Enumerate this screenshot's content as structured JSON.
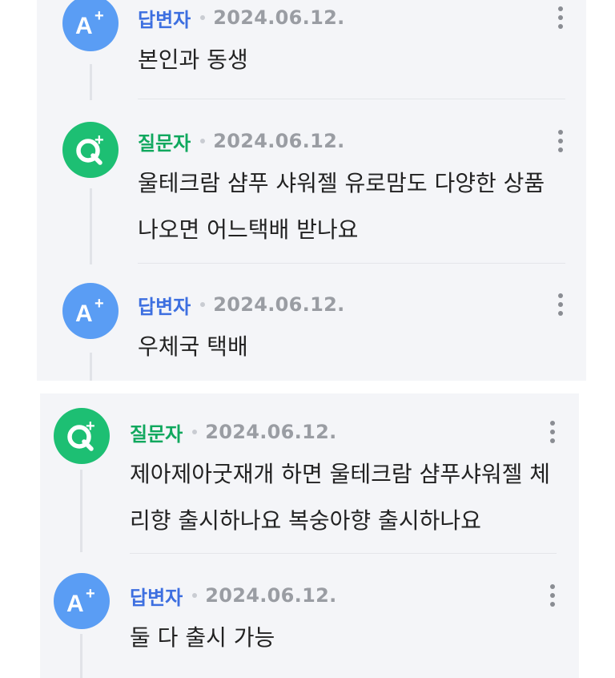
{
  "panels": [
    {
      "messages": [
        {
          "role": "답변자",
          "type": "answer",
          "date": "2024.06.12.",
          "lines": [
            "본인과 동생"
          ]
        },
        {
          "role": "질문자",
          "type": "question",
          "date": "2024.06.12.",
          "lines": [
            "울테크람 샴푸 샤워젤 유로맘도 다양한 상품",
            "나오면 어느택배 받나요"
          ]
        },
        {
          "role": "답변자",
          "type": "answer",
          "date": "2024.06.12.",
          "lines": [
            "우체국 택배"
          ]
        }
      ]
    },
    {
      "messages": [
        {
          "role": "질문자",
          "type": "question",
          "date": "2024.06.12.",
          "lines": [
            "제아제아굿재개 하면 울테크람 샴푸샤워젤 체",
            "리향 출시하나요 복숭아향 출시하나요"
          ]
        },
        {
          "role": "답변자",
          "type": "answer",
          "date": "2024.06.12.",
          "lines": [
            "둘 다 출시 가능"
          ]
        }
      ]
    }
  ],
  "icons": {
    "answer_avatar": "answer-avatar-icon",
    "question_avatar": "question-avatar-icon",
    "more": "more-options-icon"
  },
  "colors": {
    "answer_avatar": "#5a9df4",
    "question_avatar": "#1dbf73",
    "answer_role": "#3d6fe0",
    "question_role": "#10a85e",
    "panel_background": "#f4f5f8"
  }
}
